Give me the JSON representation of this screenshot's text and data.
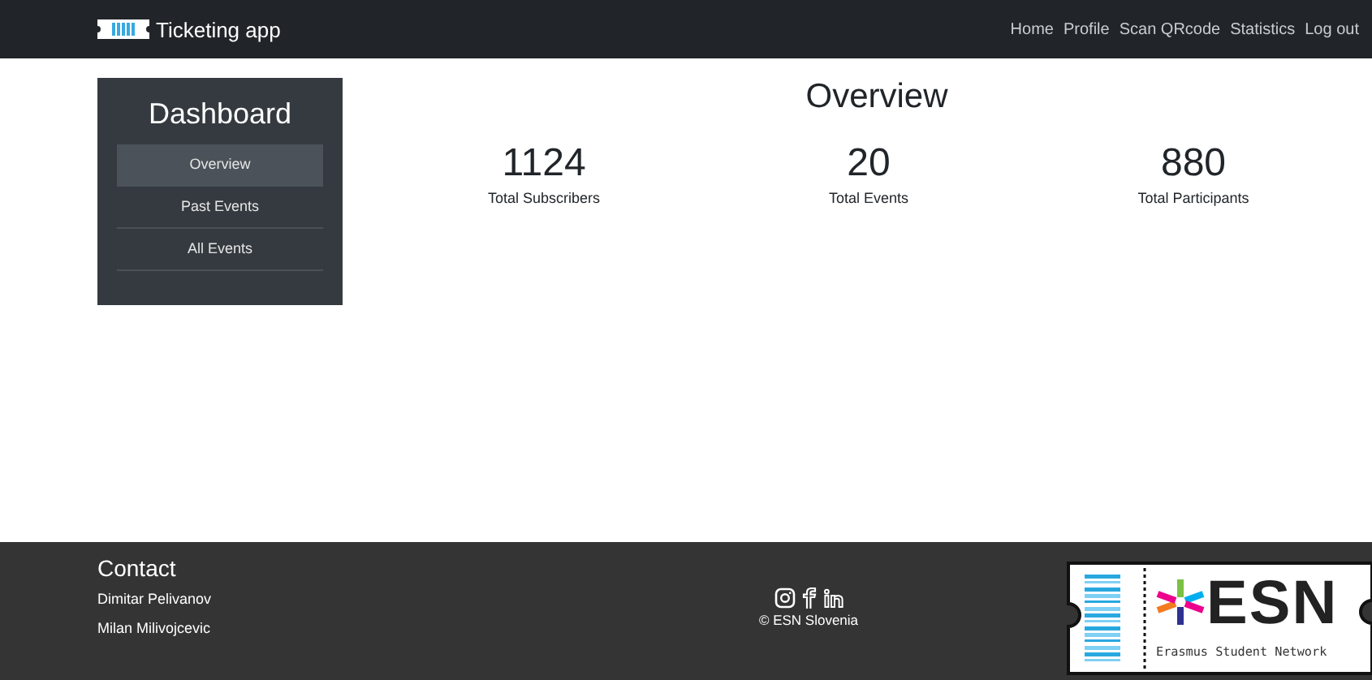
{
  "navbar": {
    "brand": "Ticketing app",
    "links": [
      "Home",
      "Profile",
      "Scan QRcode",
      "Statistics",
      "Log out"
    ]
  },
  "sidebar": {
    "title": "Dashboard",
    "items": [
      {
        "label": "Overview",
        "selected": true
      },
      {
        "label": "Past Events",
        "selected": false
      },
      {
        "label": "All Events",
        "selected": false
      }
    ]
  },
  "main": {
    "title": "Overview",
    "stats": [
      {
        "value": "1124",
        "label": "Total Subscribers"
      },
      {
        "value": "20",
        "label": "Total Events"
      },
      {
        "value": "880",
        "label": "Total Participants"
      }
    ]
  },
  "footer": {
    "heading": "Contact",
    "contacts": [
      "Dimitar Pelivanov",
      "Milan Milivojcevic"
    ],
    "copyright": "© ESN Slovenia",
    "logo": {
      "name": "ESN",
      "tagline": "Erasmus Student Network"
    }
  }
}
